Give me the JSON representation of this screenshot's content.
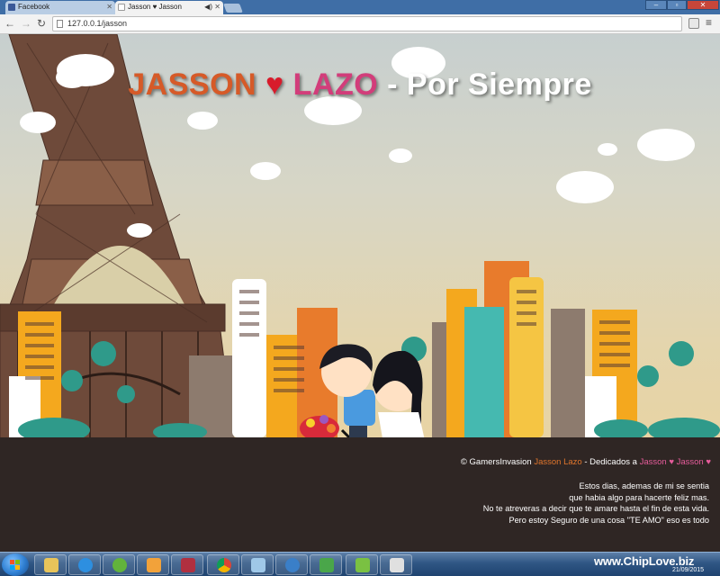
{
  "browser": {
    "tabs": [
      {
        "label": "Facebook",
        "active": false
      },
      {
        "label": "Jasson ♥ Jasson",
        "active": true
      }
    ],
    "url": "127.0.0.1/jasson",
    "window_buttons": {
      "minimize": "‒",
      "maximize": "▫",
      "close": "✕"
    }
  },
  "page": {
    "title": {
      "name1": "JASSON",
      "heart": "♥",
      "name2": "LAZO",
      "rest": " - Por Siempre"
    },
    "credit": {
      "prefix": "© GamersInvasion",
      "author": "Jasson Lazo",
      "middle": "- Dedicados a",
      "dedicatee": "Jasson ♥ Jasson",
      "heart": "♥"
    },
    "poem": [
      "Estos dias, ademas de mi se sentia",
      "que habia algo para hacerte feliz mas.",
      "No te atreveras a decir que te amare hasta el fin de esta vida.",
      "Pero estoy Seguro de una cosa \"TE AMO\" eso es todo"
    ]
  },
  "taskbar": {
    "apps": [
      "explorer",
      "internet-explorer",
      "utorrent",
      "media-player",
      "game",
      "chrome",
      "notes",
      "network",
      "monitor",
      "bluestacks",
      "paint"
    ],
    "brand": "www.ChipLove.biz",
    "date": "21/09/2015"
  },
  "colors": {
    "name1": "#d65a28",
    "name2": "#d23d7a",
    "footer_bg": "#2f2624",
    "accent_orange": "#e0752c",
    "accent_pink": "#e65c9b"
  }
}
